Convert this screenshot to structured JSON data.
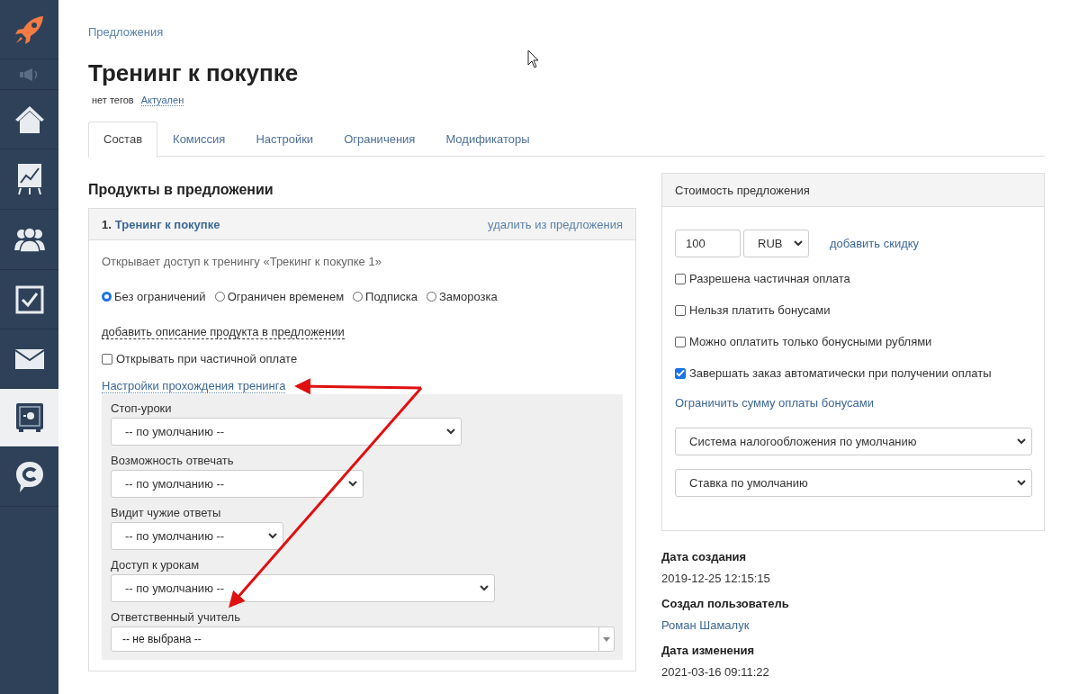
{
  "sidebar": {
    "items": [
      {
        "kind": "logo",
        "selected": false
      },
      {
        "kind": "speaker",
        "selected": false
      },
      {
        "kind": "home",
        "selected": false
      },
      {
        "kind": "chart",
        "selected": false
      },
      {
        "kind": "people",
        "selected": false
      },
      {
        "kind": "tasks",
        "selected": false
      },
      {
        "kind": "mail",
        "selected": false
      },
      {
        "kind": "safe",
        "selected": true
      },
      {
        "kind": "chat",
        "selected": false
      }
    ]
  },
  "breadcrumb": "Предложения",
  "title": "Тренинг к покупке",
  "tags": {
    "label": "нет тегов",
    "status": "Актуален"
  },
  "tabs": [
    {
      "label": "Состав",
      "selected": true
    },
    {
      "label": "Комиссия",
      "selected": false
    },
    {
      "label": "Настройки",
      "selected": false
    },
    {
      "label": "Ограничения",
      "selected": false
    },
    {
      "label": "Модификаторы",
      "selected": false
    }
  ],
  "products": {
    "heading": "Продукты в предложении",
    "item": {
      "number": "1.",
      "name": "Тренинг к покупке",
      "remove": "удалить из предложения",
      "description": "Открывает доступ к тренингу «Трекинг к покупке 1»",
      "access_options": [
        {
          "label": "Без ограничений",
          "selected": true
        },
        {
          "label": "Ограничен временем",
          "selected": false
        },
        {
          "label": "Подписка",
          "selected": false
        },
        {
          "label": "Заморозка",
          "selected": false
        }
      ],
      "add_description": "добавить описание продукта в предложении",
      "partial_open": {
        "label": "Открывать при частичной оплате",
        "checked": false
      },
      "settings_link": "Настройки прохождения тренинга",
      "settings": [
        {
          "label": "Стоп-уроки",
          "value": "-- по умолчанию --",
          "kind": "select"
        },
        {
          "label": "Возможность отвечать",
          "value": "-- по умолчанию --",
          "kind": "select"
        },
        {
          "label": "Видит чужие ответы",
          "value": "-- по умолчанию --",
          "kind": "select"
        },
        {
          "label": "Доступ к урокам",
          "value": "-- по умолчанию --",
          "kind": "select"
        },
        {
          "label": "Ответственный учитель",
          "value": "-- не выбрана --",
          "kind": "combobox"
        }
      ]
    }
  },
  "price": {
    "heading": "Стоимость предложения",
    "amount": "100",
    "currency": "RUB",
    "discount_link": "добавить скидку",
    "options": [
      {
        "label": "Разрешена частичная оплата",
        "checked": false
      },
      {
        "label": "Нельзя платить бонусами",
        "checked": false
      },
      {
        "label": "Можно оплатить только бонусными рублями",
        "checked": false
      },
      {
        "label": "Завершать заказ автоматически при получении оплаты",
        "checked": true
      }
    ],
    "bonus_limit_link": "Ограничить сумму оплаты бонусами",
    "tax_system": "Система налогообложения по умолчанию",
    "tax_rate": "Ставка по умолчанию"
  },
  "info": [
    {
      "label": "Дата создания",
      "value": "2019-12-25 12:15:15",
      "kind": "text"
    },
    {
      "label": "Создал пользователь",
      "value": "Роман Шамалук",
      "kind": "link"
    },
    {
      "label": "Дата изменения",
      "value": "2021-03-16 09:11:22",
      "kind": "text"
    }
  ]
}
